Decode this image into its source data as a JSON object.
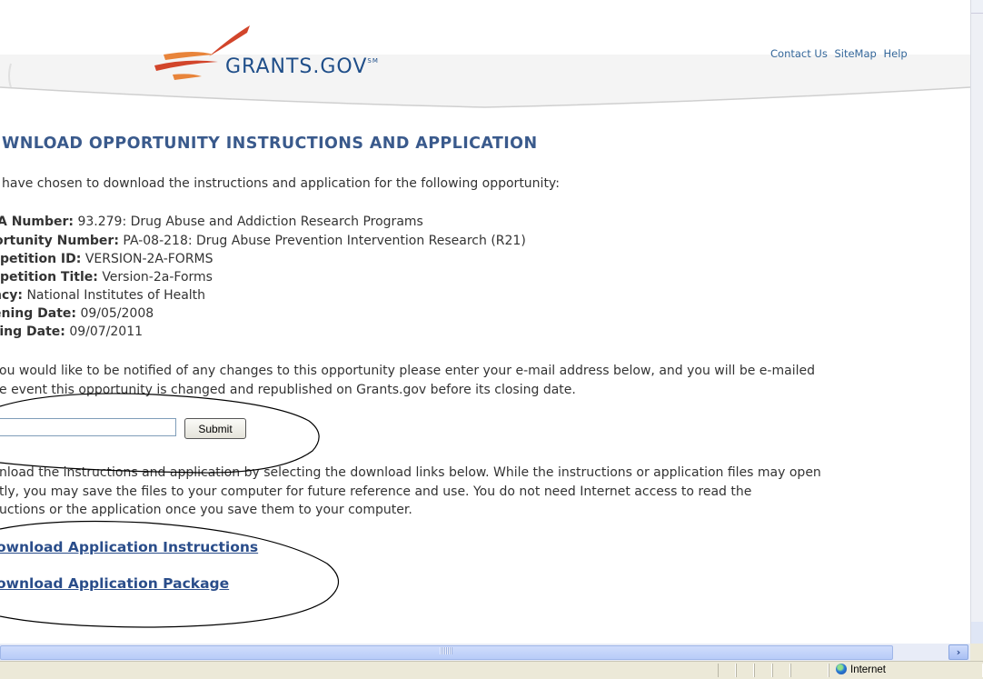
{
  "header": {
    "logo_text": "GRANTS.GOV",
    "logo_mark": "SM",
    "links": [
      "Contact Us",
      "SiteMap",
      "Help"
    ]
  },
  "page": {
    "title": "WNLOAD OPPORTUNITY INSTRUCTIONS AND APPLICATION",
    "intro": "have chosen to download the instructions and application for the following opportunity:"
  },
  "details": [
    {
      "label": "A Number:",
      "value": "93.279: Drug Abuse and Addiction Research Programs"
    },
    {
      "label": "ortunity Number:",
      "value": "PA-08-218: Drug Abuse Prevention Intervention Research (R21)"
    },
    {
      "label": "npetition ID:",
      "value": "VERSION-2A-FORMS"
    },
    {
      "label": "npetition Title:",
      "value": "Version-2a-Forms"
    },
    {
      "label": "ncy:",
      "value": "National Institutes of Health"
    },
    {
      "label": "ening Date:",
      "value": "09/05/2008"
    },
    {
      "label": "sing Date:",
      "value": "09/07/2011"
    }
  ],
  "notify": {
    "line1": "ou would like to be notified of any changes to this opportunity please enter your e-mail address below, and you will be e-mailed",
    "line2": "e event this opportunity is changed and republished on Grants.gov before its closing date.",
    "email_value": "",
    "submit_label": "Submit"
  },
  "download": {
    "line1": "nload the instructions and application by selecting the download links below. While the instructions or application files may open",
    "line2": "tly, you may save the files to your computer for future reference and use. You do not need Internet access to read the",
    "line3": "uctions or the application once you save them to your computer.",
    "link_instructions": "ownload Application Instructions",
    "link_package": "ownload Application Package"
  },
  "status": {
    "zone": "Internet"
  },
  "colors": {
    "title": "#3a5a8c",
    "link": "#2a4d8a",
    "logo": "#1f4e89",
    "swoosh_red": "#d2452b",
    "swoosh_orange": "#e8843a"
  }
}
